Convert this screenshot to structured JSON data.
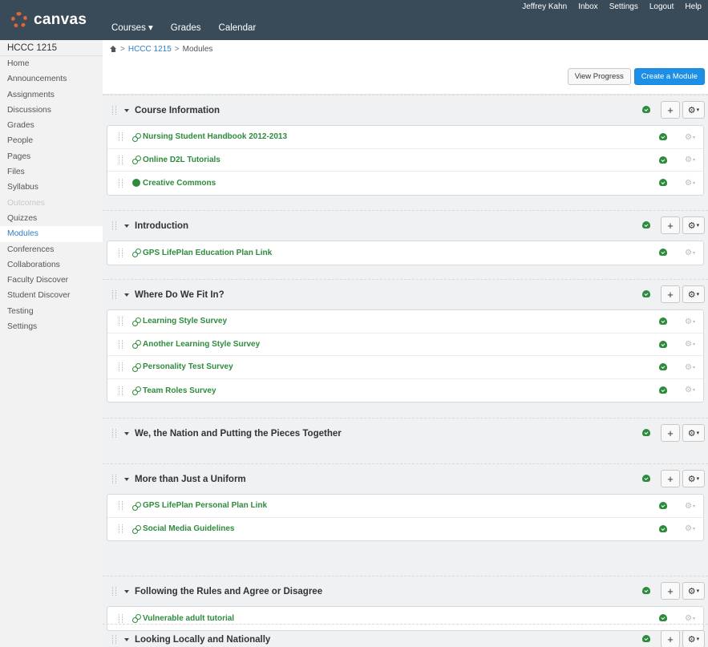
{
  "app": {
    "logo_text": "canvas"
  },
  "main_nav": [
    {
      "label": "Courses ▾"
    },
    {
      "label": "Grades"
    },
    {
      "label": "Calendar"
    }
  ],
  "user_nav": [
    {
      "label": "Jeffrey Kahn"
    },
    {
      "label": "Inbox"
    },
    {
      "label": "Settings"
    },
    {
      "label": "Logout"
    },
    {
      "label": "Help"
    }
  ],
  "sidebar": {
    "course_title": "HCCC 1215",
    "items": [
      {
        "label": "Home"
      },
      {
        "label": "Announcements"
      },
      {
        "label": "Assignments"
      },
      {
        "label": "Discussions"
      },
      {
        "label": "Grades"
      },
      {
        "label": "People"
      },
      {
        "label": "Pages"
      },
      {
        "label": "Files"
      },
      {
        "label": "Syllabus"
      },
      {
        "label": "Outcomes"
      },
      {
        "label": "Quizzes"
      },
      {
        "label": "Modules"
      },
      {
        "label": "Conferences"
      },
      {
        "label": "Collaborations"
      },
      {
        "label": "Faculty Discover"
      },
      {
        "label": "Student Discover"
      },
      {
        "label": "Testing"
      },
      {
        "label": "Settings"
      }
    ]
  },
  "breadcrumb": {
    "course": "HCCC 1215",
    "page": "Modules",
    "separator": ">"
  },
  "header": {
    "view_progress": "View Progress",
    "create_module": "Create a Module"
  },
  "icons": {
    "module_add": "+",
    "gear": "⚙",
    "caret": "▾"
  },
  "colors": {
    "accent": "#1d8fe6",
    "published": "#2e8b3d",
    "topbar": "#394b58"
  },
  "modules": [
    {
      "title": "Course Information",
      "items": [
        {
          "title": "Nursing Student Handbook 2012-2013",
          "icon": "link-icon"
        },
        {
          "title": "Online D2L Tutorials",
          "icon": "link-icon"
        },
        {
          "title": "Creative Commons",
          "icon": "cc-icon"
        }
      ]
    },
    {
      "title": "Introduction",
      "items": [
        {
          "title": "GPS LifePlan Education Plan Link",
          "icon": "link-icon"
        }
      ]
    },
    {
      "title": "Where Do We Fit In?",
      "items": [
        {
          "title": "Learning Style Survey",
          "icon": "link-icon"
        },
        {
          "title": "Another Learning Style Survey",
          "icon": "link-icon"
        },
        {
          "title": "Personality Test Survey",
          "icon": "link-icon"
        },
        {
          "title": "Team Roles Survey",
          "icon": "link-icon"
        }
      ]
    },
    {
      "title": "We, the Nation and Putting the Pieces Together",
      "items": []
    },
    {
      "title": "More than Just a Uniform",
      "items": [
        {
          "title": "GPS LifePlan Personal Plan Link",
          "icon": "link-icon"
        },
        {
          "title": "Social Media Guidelines",
          "icon": "link-icon"
        }
      ]
    },
    {
      "title": "Following the Rules and Agree or Disagree",
      "items": [
        {
          "title": "Vulnerable adult tutorial",
          "icon": "link-icon"
        }
      ]
    },
    {
      "title": "Looking Locally and Nationally",
      "items": []
    }
  ]
}
